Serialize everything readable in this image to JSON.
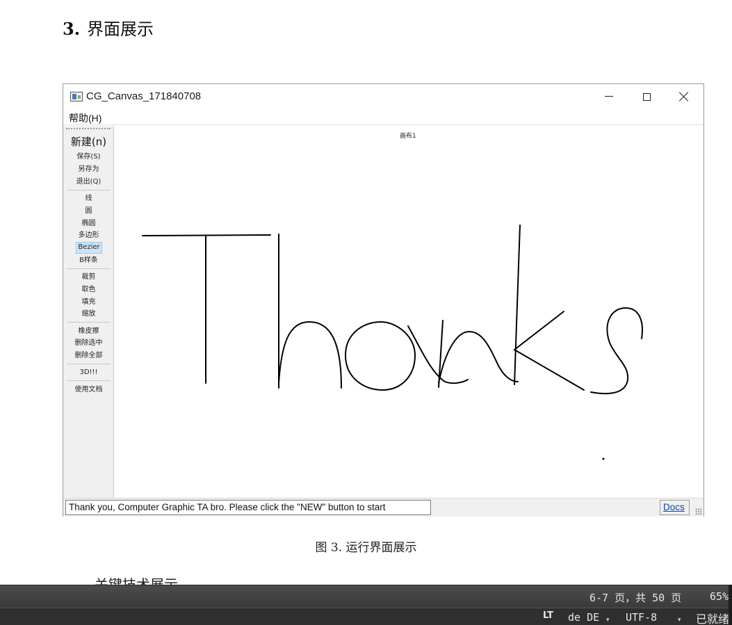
{
  "heading": {
    "number": "3.",
    "text": "界面展示"
  },
  "window": {
    "title": "CG_Canvas_171840708",
    "controls": {
      "minimize": "—",
      "maximize": "☐",
      "close": "✕"
    },
    "menu": {
      "help": "帮助(H)"
    },
    "toolbar": {
      "new": "新建(n)",
      "save": "保存(S)",
      "save_as": "另存为",
      "exit": "退出(Q)",
      "line": "线",
      "circle": "圆",
      "ellipse": "椭圆",
      "polygon": "多边形",
      "bezier": "Bezier",
      "bspline": "B样条",
      "clip": "裁剪",
      "pick_color": "取色",
      "fill": "填充",
      "scale": "缩放",
      "eraser": "橡皮擦",
      "delete_selected": "删除选中",
      "delete_all": "删除全部",
      "three_d": "3D!!!",
      "manual": "使用文档",
      "selected": "bezier"
    },
    "canvas": {
      "tab_label": "画布1",
      "stroke_color": "#000000",
      "background": "#ffffff"
    },
    "status": {
      "message": "Thank you, Computer Graphic TA bro. Please click the \"NEW\" button to start",
      "docs_link": "Docs"
    }
  },
  "caption": "图 3. 运行界面展示",
  "next_section_partial": "关键技术展示",
  "document_statusbar": {
    "page_info": "6-7 页，共 50 页",
    "zoom": "65%",
    "language_tool": "LT",
    "language": "de DE",
    "encoding": "UTF-8",
    "state": "已就绪"
  },
  "colors": {
    "selected_tool_bg": "#cce4f7",
    "toolbar_bg": "#f0f0f0",
    "link": "#0645ad",
    "doc_bar": "#3a3a3a"
  }
}
